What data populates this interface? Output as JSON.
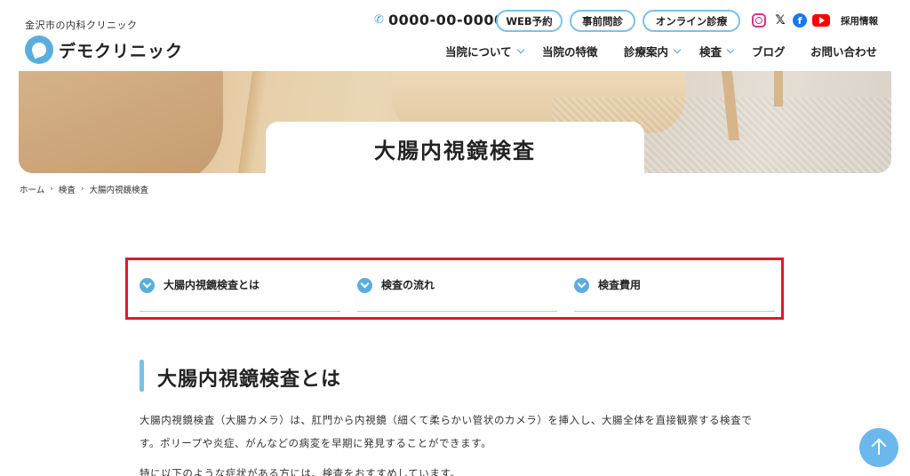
{
  "header": {
    "tagline": "金沢市の内科クリニック",
    "logo_text": "デモクリニック",
    "phone": "0000-00-0000",
    "buttons": {
      "web_reservation": "WEB予約",
      "pre_questionnaire": "事前問診",
      "online_consult": "オンライン診療"
    },
    "social_icons": [
      "instagram-icon",
      "x-icon",
      "facebook-icon",
      "youtube-icon"
    ],
    "recruit": "採用情報",
    "nav": [
      {
        "label": "当院について",
        "dropdown": true
      },
      {
        "label": "当院の特徴",
        "dropdown": false
      },
      {
        "label": "診療案内",
        "dropdown": true
      },
      {
        "label": "検査",
        "dropdown": true
      },
      {
        "label": "ブログ",
        "dropdown": false
      },
      {
        "label": "お問い合わせ",
        "dropdown": false
      }
    ]
  },
  "hero": {
    "title": "大腸内視鏡検査"
  },
  "breadcrumb": [
    "ホーム",
    "検査",
    "大腸内視鏡検査"
  ],
  "toc": [
    {
      "label": "大腸内視鏡検査とは"
    },
    {
      "label": "検査の流れ"
    },
    {
      "label": "検査費用"
    }
  ],
  "section": {
    "title": "大腸内視鏡検査とは",
    "para1_line1": "大腸内視鏡検査（大腸カメラ）は、肛門から内視鏡（細くて柔らかい管状のカメラ）を挿入し、大腸全体を直接観察する検査で",
    "para1_line2": "す。ポリープや炎症、がんなどの病変を早期に発見することができます。",
    "para2": "特に以下のような症状がある方には、検査をおすすめしています。"
  },
  "colors": {
    "accent": "#5aaedf",
    "highlight_border": "#e0182d"
  }
}
